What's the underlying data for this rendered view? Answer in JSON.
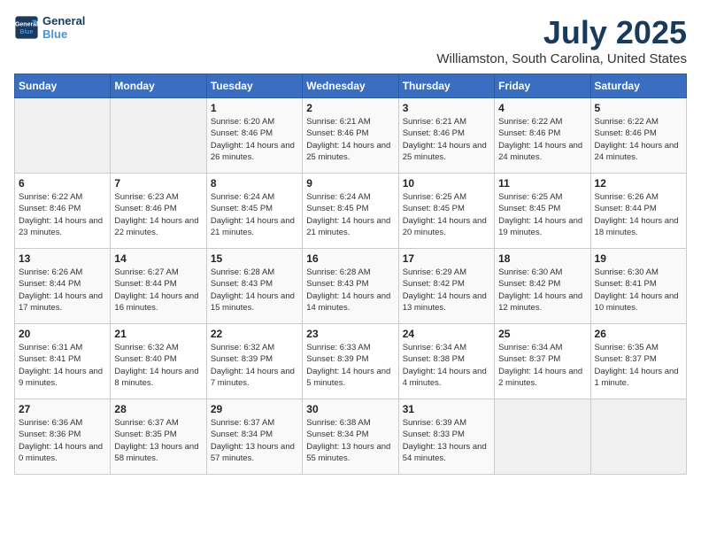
{
  "header": {
    "logo_line1": "General",
    "logo_line2": "Blue",
    "month": "July 2025",
    "location": "Williamston, South Carolina, United States"
  },
  "days_of_week": [
    "Sunday",
    "Monday",
    "Tuesday",
    "Wednesday",
    "Thursday",
    "Friday",
    "Saturday"
  ],
  "weeks": [
    [
      {
        "day": "",
        "info": ""
      },
      {
        "day": "",
        "info": ""
      },
      {
        "day": "1",
        "info": "Sunrise: 6:20 AM\nSunset: 8:46 PM\nDaylight: 14 hours\nand 26 minutes."
      },
      {
        "day": "2",
        "info": "Sunrise: 6:21 AM\nSunset: 8:46 PM\nDaylight: 14 hours\nand 25 minutes."
      },
      {
        "day": "3",
        "info": "Sunrise: 6:21 AM\nSunset: 8:46 PM\nDaylight: 14 hours\nand 25 minutes."
      },
      {
        "day": "4",
        "info": "Sunrise: 6:22 AM\nSunset: 8:46 PM\nDaylight: 14 hours\nand 24 minutes."
      },
      {
        "day": "5",
        "info": "Sunrise: 6:22 AM\nSunset: 8:46 PM\nDaylight: 14 hours\nand 24 minutes."
      }
    ],
    [
      {
        "day": "6",
        "info": "Sunrise: 6:22 AM\nSunset: 8:46 PM\nDaylight: 14 hours\nand 23 minutes."
      },
      {
        "day": "7",
        "info": "Sunrise: 6:23 AM\nSunset: 8:46 PM\nDaylight: 14 hours\nand 22 minutes."
      },
      {
        "day": "8",
        "info": "Sunrise: 6:24 AM\nSunset: 8:45 PM\nDaylight: 14 hours\nand 21 minutes."
      },
      {
        "day": "9",
        "info": "Sunrise: 6:24 AM\nSunset: 8:45 PM\nDaylight: 14 hours\nand 21 minutes."
      },
      {
        "day": "10",
        "info": "Sunrise: 6:25 AM\nSunset: 8:45 PM\nDaylight: 14 hours\nand 20 minutes."
      },
      {
        "day": "11",
        "info": "Sunrise: 6:25 AM\nSunset: 8:45 PM\nDaylight: 14 hours\nand 19 minutes."
      },
      {
        "day": "12",
        "info": "Sunrise: 6:26 AM\nSunset: 8:44 PM\nDaylight: 14 hours\nand 18 minutes."
      }
    ],
    [
      {
        "day": "13",
        "info": "Sunrise: 6:26 AM\nSunset: 8:44 PM\nDaylight: 14 hours\nand 17 minutes."
      },
      {
        "day": "14",
        "info": "Sunrise: 6:27 AM\nSunset: 8:44 PM\nDaylight: 14 hours\nand 16 minutes."
      },
      {
        "day": "15",
        "info": "Sunrise: 6:28 AM\nSunset: 8:43 PM\nDaylight: 14 hours\nand 15 minutes."
      },
      {
        "day": "16",
        "info": "Sunrise: 6:28 AM\nSunset: 8:43 PM\nDaylight: 14 hours\nand 14 minutes."
      },
      {
        "day": "17",
        "info": "Sunrise: 6:29 AM\nSunset: 8:42 PM\nDaylight: 14 hours\nand 13 minutes."
      },
      {
        "day": "18",
        "info": "Sunrise: 6:30 AM\nSunset: 8:42 PM\nDaylight: 14 hours\nand 12 minutes."
      },
      {
        "day": "19",
        "info": "Sunrise: 6:30 AM\nSunset: 8:41 PM\nDaylight: 14 hours\nand 10 minutes."
      }
    ],
    [
      {
        "day": "20",
        "info": "Sunrise: 6:31 AM\nSunset: 8:41 PM\nDaylight: 14 hours\nand 9 minutes."
      },
      {
        "day": "21",
        "info": "Sunrise: 6:32 AM\nSunset: 8:40 PM\nDaylight: 14 hours\nand 8 minutes."
      },
      {
        "day": "22",
        "info": "Sunrise: 6:32 AM\nSunset: 8:39 PM\nDaylight: 14 hours\nand 7 minutes."
      },
      {
        "day": "23",
        "info": "Sunrise: 6:33 AM\nSunset: 8:39 PM\nDaylight: 14 hours\nand 5 minutes."
      },
      {
        "day": "24",
        "info": "Sunrise: 6:34 AM\nSunset: 8:38 PM\nDaylight: 14 hours\nand 4 minutes."
      },
      {
        "day": "25",
        "info": "Sunrise: 6:34 AM\nSunset: 8:37 PM\nDaylight: 14 hours\nand 2 minutes."
      },
      {
        "day": "26",
        "info": "Sunrise: 6:35 AM\nSunset: 8:37 PM\nDaylight: 14 hours\nand 1 minute."
      }
    ],
    [
      {
        "day": "27",
        "info": "Sunrise: 6:36 AM\nSunset: 8:36 PM\nDaylight: 14 hours\nand 0 minutes."
      },
      {
        "day": "28",
        "info": "Sunrise: 6:37 AM\nSunset: 8:35 PM\nDaylight: 13 hours\nand 58 minutes."
      },
      {
        "day": "29",
        "info": "Sunrise: 6:37 AM\nSunset: 8:34 PM\nDaylight: 13 hours\nand 57 minutes."
      },
      {
        "day": "30",
        "info": "Sunrise: 6:38 AM\nSunset: 8:34 PM\nDaylight: 13 hours\nand 55 minutes."
      },
      {
        "day": "31",
        "info": "Sunrise: 6:39 AM\nSunset: 8:33 PM\nDaylight: 13 hours\nand 54 minutes."
      },
      {
        "day": "",
        "info": ""
      },
      {
        "day": "",
        "info": ""
      }
    ]
  ]
}
